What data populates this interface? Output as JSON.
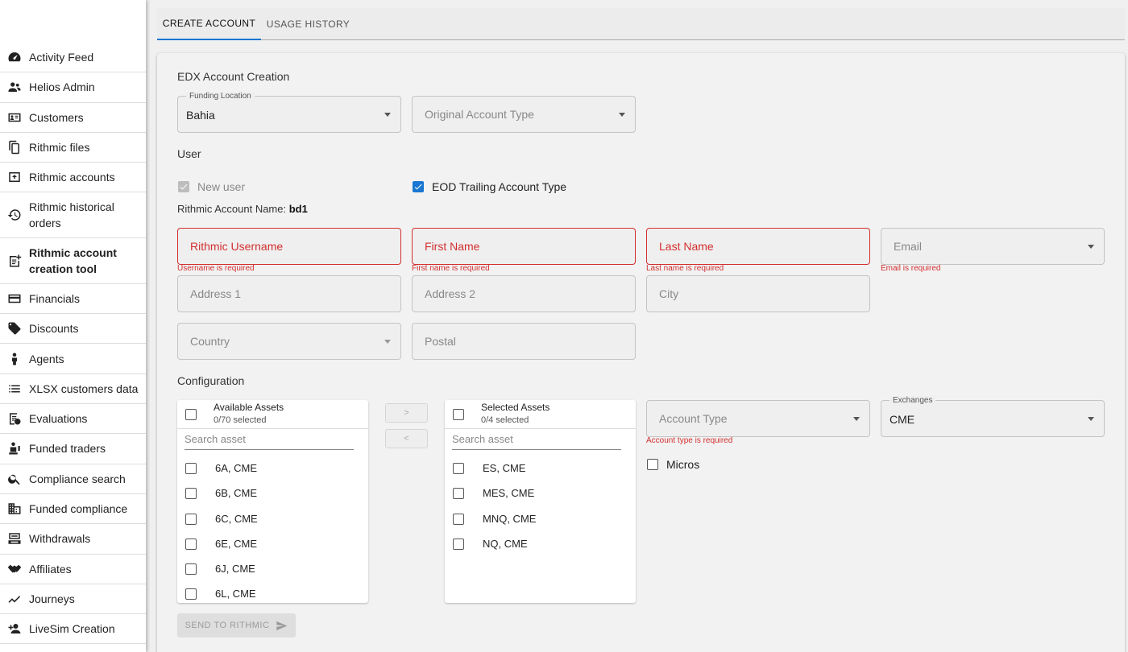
{
  "sidebar": {
    "items": [
      {
        "label": "Activity Feed",
        "icon": "speedometer-icon"
      },
      {
        "label": "Helios Admin",
        "icon": "people-icon"
      },
      {
        "label": "Customers",
        "icon": "id-card-icon"
      },
      {
        "label": "Rithmic files",
        "icon": "files-icon"
      },
      {
        "label": "Rithmic accounts",
        "icon": "upload-box-icon"
      },
      {
        "label": "Rithmic historical orders",
        "icon": "history-icon"
      },
      {
        "label": "Rithmic account creation tool",
        "icon": "note-add-icon"
      },
      {
        "label": "Financials",
        "icon": "credit-card-icon"
      },
      {
        "label": "Discounts",
        "icon": "tag-icon"
      },
      {
        "label": "Agents",
        "icon": "person-icon"
      },
      {
        "label": "XLSX customers data",
        "icon": "list-icon"
      },
      {
        "label": "Evaluations",
        "icon": "clipboard-check-icon"
      },
      {
        "label": "Funded traders",
        "icon": "money-person-icon"
      },
      {
        "label": "Compliance search",
        "icon": "search-icon"
      },
      {
        "label": "Funded compliance",
        "icon": "building-icon"
      },
      {
        "label": "Withdrawals",
        "icon": "cash-register-icon"
      },
      {
        "label": "Affiliates",
        "icon": "handshake-icon"
      },
      {
        "label": "Journeys",
        "icon": "trend-line-icon"
      },
      {
        "label": "LiveSim Creation",
        "icon": "person-add-icon"
      }
    ]
  },
  "tabs": {
    "create": "CREATE ACCOUNT",
    "usage": "USAGE HISTORY"
  },
  "form": {
    "section_title": "EDX Account Creation",
    "funding_location": {
      "legend": "Funding Location",
      "value": "Bahia"
    },
    "original_account_type": {
      "placeholder": "Original Account Type"
    },
    "user_title": "User",
    "new_user": {
      "label": "New user",
      "checked": true
    },
    "eod_trailing": {
      "label": "EOD Trailing Account Type",
      "checked": true
    },
    "account_name": {
      "label": "Rithmic Account Name:",
      "value": "bd1"
    },
    "rithmic_username": {
      "placeholder": "Rithmic Username",
      "error": "Username is required"
    },
    "first_name": {
      "placeholder": "First Name",
      "error": "First name is required"
    },
    "last_name": {
      "placeholder": "Last Name",
      "error": "Last name is required"
    },
    "email": {
      "placeholder": "Email",
      "error": "Email is required"
    },
    "address1": {
      "placeholder": "Address 1"
    },
    "address2": {
      "placeholder": "Address 2"
    },
    "city": {
      "placeholder": "City"
    },
    "country": {
      "placeholder": "Country"
    },
    "postal": {
      "placeholder": "Postal"
    },
    "config_title": "Configuration",
    "available": {
      "title": "Available Assets",
      "count": "0/70 selected",
      "search_placeholder": "Search asset",
      "items": [
        "6A, CME",
        "6B, CME",
        "6C, CME",
        "6E, CME",
        "6J, CME",
        "6L, CME"
      ]
    },
    "selected": {
      "title": "Selected Assets",
      "count": "0/4 selected",
      "search_placeholder": "Search asset",
      "items": [
        "ES, CME",
        "MES, CME",
        "MNQ, CME",
        "NQ, CME"
      ]
    },
    "move_right": ">",
    "move_left": "<",
    "account_type": {
      "placeholder": "Account Type",
      "error": "Account type is required"
    },
    "exchanges": {
      "legend": "Exchanges",
      "value": "CME"
    },
    "micros": {
      "label": "Micros",
      "checked": false
    },
    "send_button": "SEND TO RITHMIC"
  },
  "colors": {
    "accent": "#1976d2",
    "error": "#d32f2f"
  }
}
